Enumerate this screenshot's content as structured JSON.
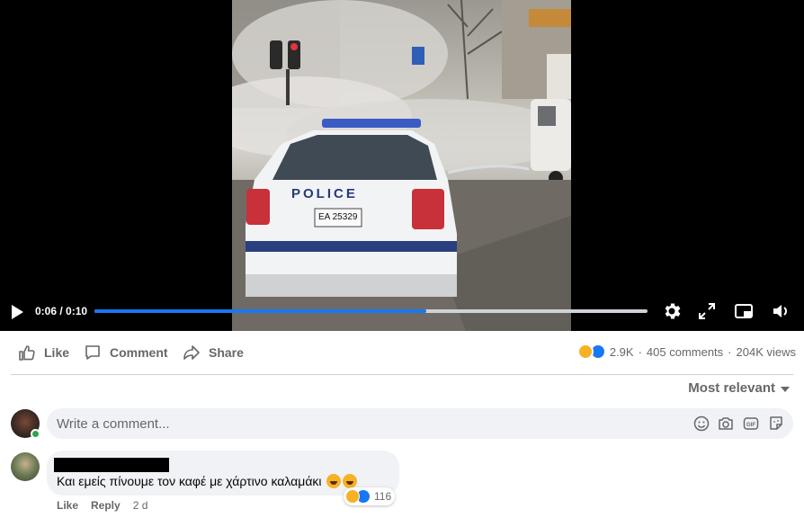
{
  "video": {
    "current_time": "0:06",
    "duration": "0:10",
    "progress_fraction": 0.6,
    "car_label": "POLICE",
    "car_plate": "ΕΑ 25329"
  },
  "actions": {
    "like_label": "Like",
    "comment_label": "Comment",
    "share_label": "Share"
  },
  "stats": {
    "reactions_count": "2.9K",
    "comments": "405 comments",
    "separator": "·",
    "views": "204K views"
  },
  "sort": {
    "label": "Most relevant"
  },
  "composer": {
    "placeholder": "Write a comment..."
  },
  "comment": {
    "text": "Και εμείς πίνουμε τον καφέ με χάρτινο καλαμάκι",
    "reactions_count": "116",
    "like_label": "Like",
    "reply_label": "Reply",
    "age": "2 d"
  },
  "colors": {
    "accent": "#1877f2",
    "muted_text": "#65676b",
    "bubble_bg": "#f0f2f5",
    "online": "#31a24c"
  }
}
